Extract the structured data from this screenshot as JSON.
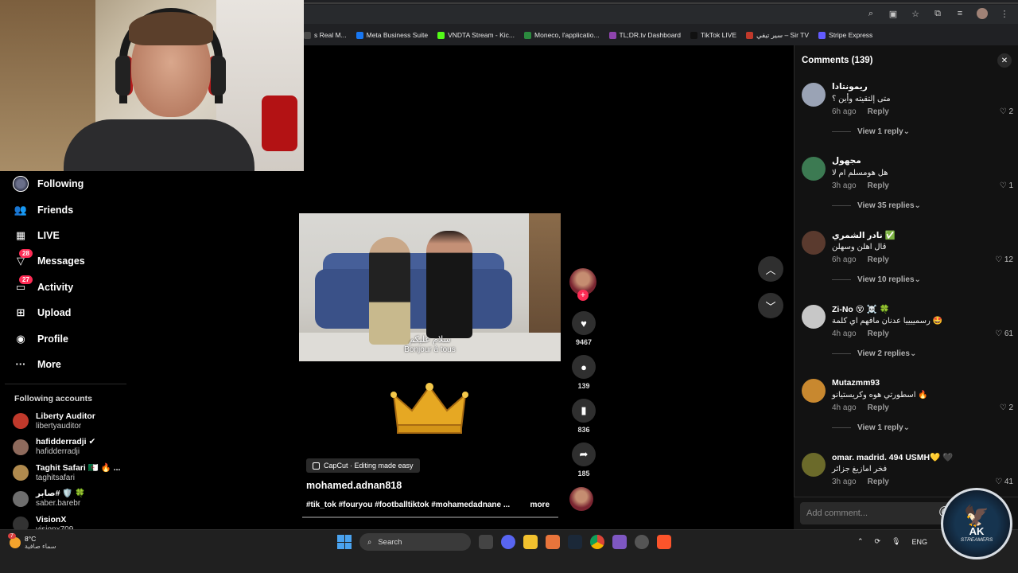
{
  "bookmarks": [
    {
      "label": "s Real M...",
      "color": "#4a4a4a"
    },
    {
      "label": "Meta Business Suite",
      "color": "#1877f2"
    },
    {
      "label": "VNDTA Stream - Kic...",
      "color": "#53fc18"
    },
    {
      "label": "Moneco, l'applicatio...",
      "color": "#2b8a3e"
    },
    {
      "label": "TL;DR.tv Dashboard",
      "color": "#8e44ad"
    },
    {
      "label": "TikTok LIVE",
      "color": "#111111"
    },
    {
      "label": "سير تيفي – Sir TV",
      "color": "#c0392b"
    },
    {
      "label": "Stripe Express",
      "color": "#635bff"
    }
  ],
  "sidebar": {
    "items": [
      {
        "label": "Following",
        "icon": "following-avatar-icon"
      },
      {
        "label": "Friends",
        "icon": "friends-icon"
      },
      {
        "label": "LIVE",
        "icon": "live-icon"
      },
      {
        "label": "Messages",
        "icon": "messages-icon",
        "badge": "28"
      },
      {
        "label": "Activity",
        "icon": "activity-icon",
        "badge": "27"
      },
      {
        "label": "Upload",
        "icon": "upload-icon"
      },
      {
        "label": "Profile",
        "icon": "profile-icon"
      },
      {
        "label": "More",
        "icon": "more-icon"
      }
    ],
    "following_title": "Following accounts",
    "accounts": [
      {
        "name": "Liberty Auditor",
        "handle": "libertyauditor",
        "color": "#c0392b"
      },
      {
        "name": "hafidderradji ✔",
        "handle": "hafidderradji",
        "color": "#8e6a5c"
      },
      {
        "name": "Taghit Safari 🇩🇿 🔥 ...",
        "handle": "taghitsafari",
        "color": "#b08a4e"
      },
      {
        "name": "صابر# 🛡️ 🍀",
        "handle": "saber.barebr",
        "color": "#6e6e6e"
      },
      {
        "name": "VisionX",
        "handle": "visionx709",
        "color": "#333"
      }
    ]
  },
  "video": {
    "subtitle_ar": "سلام عليكم",
    "subtitle_fr": "Bonjour à tous",
    "capcut_label": "CapCut · Editing made easy",
    "author": "mohamed.adnan818",
    "caption": "#tik_tok #fouryou #footballtiktok #mohamedadnane ...",
    "more_label": "more",
    "likes": "9467",
    "comments": "139",
    "saves": "836",
    "shares": "185"
  },
  "comments_panel": {
    "title": "Comments (139)",
    "reply_label": "Reply",
    "placeholder": "Add comment...",
    "items": [
      {
        "user": "ريمونتادا",
        "text": "متى إلتقيته وأين ؟",
        "time": "6h ago",
        "likes": "2",
        "view": "View 1 reply",
        "color": "#9aa3b5"
      },
      {
        "user": "مجهول",
        "text": "هل هومسلم ام لا",
        "time": "3h ago",
        "likes": "1",
        "view": "View 35 replies",
        "color": "#3c7a52"
      },
      {
        "user": "نادر الشمري ✅",
        "text": "قال اهلن وسهلن",
        "time": "6h ago",
        "likes": "12",
        "view": "View 10 replies",
        "color": "#5a3a2e"
      },
      {
        "user": "Zi-No 😵 ☠️ 🍀",
        "text": "رسمييييا عدنان مافهم اي كلمة 🤩",
        "time": "4h ago",
        "likes": "61",
        "view": "View 2 replies",
        "color": "#c7c7c7"
      },
      {
        "user": "Mutazmm93",
        "text": "اسطورتي هوه وكريستيانو 🔥",
        "time": "4h ago",
        "likes": "2",
        "view": "View 1 reply",
        "color": "#c8882f"
      },
      {
        "user": "omar. madrid. 494 USMH💛 🖤",
        "text": "فخر امازيغ جزائر",
        "time": "3h ago",
        "likes": "41",
        "view": "",
        "color": "#6b6a2a"
      }
    ]
  },
  "logo": {
    "ak": "AK",
    "sub": "STREAMERS"
  },
  "taskbar": {
    "temp": "8°C",
    "weather_text": "سماء صافية",
    "weather_badge": "7",
    "search_placeholder": "Search",
    "lang": "ENG"
  }
}
